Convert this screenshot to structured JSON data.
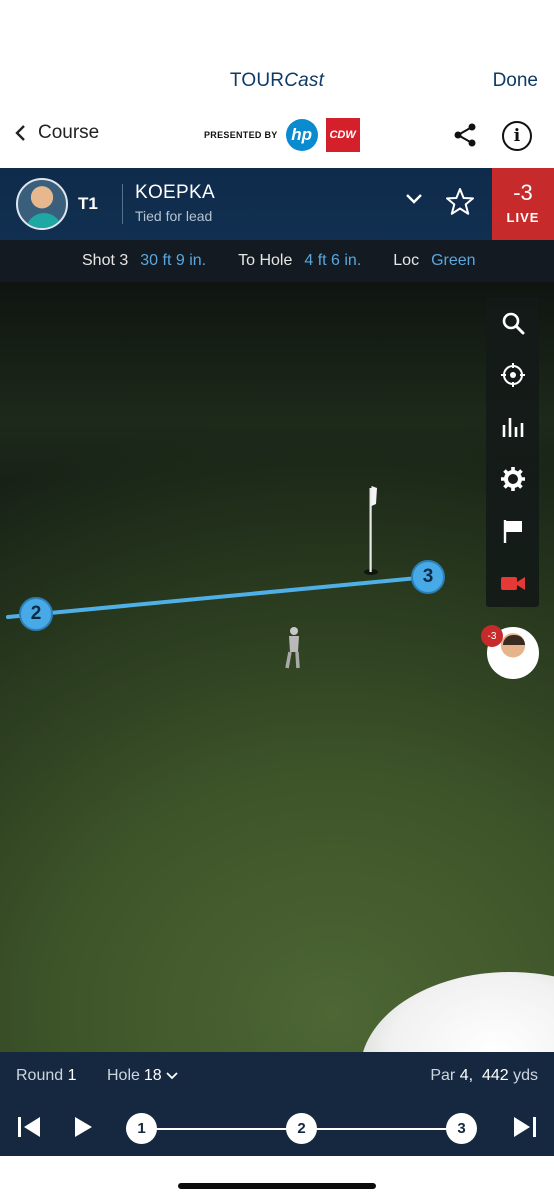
{
  "nav": {
    "title_main": "TOUR",
    "title_italic": "Cast",
    "done_label": "Done",
    "back_label": "Course",
    "presented_by": "PRESENTED BY",
    "sponsor1": "hp",
    "sponsor2": "CDW",
    "share_icon": "share-icon",
    "info_icon": "info-icon",
    "info_glyph": "i"
  },
  "player": {
    "position": "T1",
    "name": "KOEPKA",
    "status": "Tied for lead",
    "score": "-3",
    "live_label": "LIVE"
  },
  "shot": {
    "shot_label": "Shot 3",
    "shot_distance": "30 ft 9 in.",
    "to_hole_label": "To Hole",
    "to_hole_value": "4 ft 6 in.",
    "loc_label": "Loc",
    "loc_value": "Green"
  },
  "scene": {
    "markers": [
      "2",
      "3"
    ],
    "line_color": "#4fb0e8",
    "mini_score": "-3"
  },
  "toolbar": {
    "items": [
      "search-icon",
      "target-icon",
      "stats-icon",
      "settings-icon",
      "flag-icon",
      "video-icon"
    ],
    "video_color": "#e53935"
  },
  "bottom": {
    "round_label": "Round",
    "round_value": "1",
    "hole_label": "Hole",
    "hole_value": "18",
    "par_label": "Par",
    "par_value": "4,",
    "yards_value": "442",
    "yards_unit": "yds",
    "shots": [
      "1",
      "2",
      "3"
    ]
  },
  "colors": {
    "brand_navy": "#0f3a67",
    "live_red": "#c62a2a",
    "accent_blue": "#5aa7de"
  }
}
